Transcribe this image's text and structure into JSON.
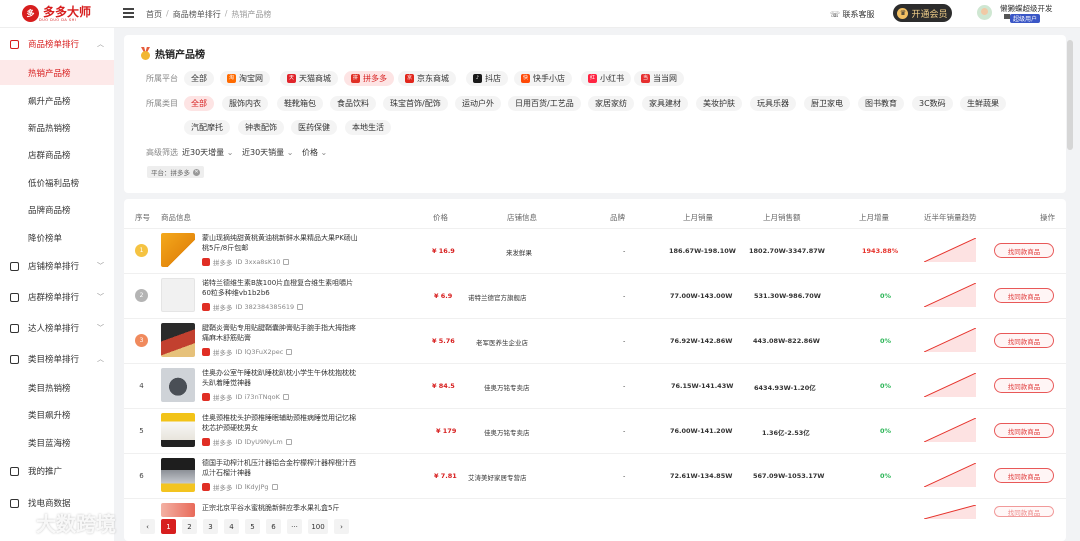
{
  "app": {
    "name": "多多大师",
    "sub": "DUO DUO DA SHI"
  },
  "breadcrumb": [
    "首页",
    "商品榜单排行",
    "热销产品榜"
  ],
  "header": {
    "contact": "联系客服",
    "vip": "开通会员",
    "user_name": "懒獭蝶超级开发",
    "user_badge": "超级用户"
  },
  "sidebar": {
    "group1": "商品榜单排行",
    "items1": [
      "热销产品榜",
      "飙升产品榜",
      "新品热销榜",
      "店群商品榜",
      "低价福利品榜",
      "品牌商品榜",
      "降价榜单"
    ],
    "group2": "店铺榜单排行",
    "group3": "店群榜单排行",
    "group4": "达人榜单排行",
    "group5": "类目榜单排行",
    "items5": [
      "类目热销榜",
      "类目飙升榜",
      "类目蓝海榜"
    ],
    "group6": "我的推广",
    "group7": "找电商数据"
  },
  "filter": {
    "title": "热销产品榜",
    "platform_label": "所属平台",
    "platforms": [
      "全部",
      "淘宝网",
      "天猫商城",
      "拼多多",
      "京东商城",
      "抖店",
      "快手小店",
      "小红书",
      "当当网"
    ],
    "category_label": "所属类目",
    "categories": [
      "全部",
      "服饰内衣",
      "鞋靴箱包",
      "食品饮料",
      "珠宝首饰/配饰",
      "运动户外",
      "日用百货/工艺品",
      "家居家纺",
      "家具建材",
      "美妆护肤",
      "玩具乐器",
      "厨卫家电",
      "图书教育",
      "3C数码",
      "生鲜蔬果",
      "汽配摩托",
      "钟表配饰",
      "医药保健",
      "本地生活"
    ],
    "advanced_label": "高级筛选",
    "selects": [
      "近30天增量",
      "近30天销量",
      "价格"
    ],
    "active_tag": "平台：拼多多"
  },
  "table": {
    "headers": [
      "序号",
      "商品信息",
      "价格",
      "店铺信息",
      "品牌",
      "上月销量",
      "上月销售额",
      "上月增量",
      "近半年销量趋势",
      "操作"
    ],
    "platform_name": "拼多多",
    "action_label": "找同款商品",
    "rows": [
      {
        "rank": "1",
        "name": "蒙山现摘纯甜黄桃黄油桃新鲜水果精品大果PK砀山桃5斤/8斤包邮",
        "id": "ID 3xxa8sK10",
        "price": "¥ 16.9",
        "shop": "来发鲜果",
        "brand": "-",
        "sales": "186.67W-198.10W",
        "revenue": "1802.70W-3347.87W",
        "growth": "1943.88%"
      },
      {
        "rank": "2",
        "name": "诺特兰德维生素B族100片血橙复合维生素咀嚼片60粒多种维vb1b2b6",
        "id": "ID 382384385619",
        "price": "¥ 6.9",
        "shop": "诺特兰德官方旗舰店",
        "brand": "-",
        "sales": "77.00W-143.00W",
        "revenue": "531.30W-986.70W",
        "growth": "0%"
      },
      {
        "rank": "3",
        "name": "腱鞘炎膏贴专用贴腱鞘囊肿膏贴手腕手指大拇指疼痛麻木舒筋贴膏",
        "id": "ID lQ3FuX2pec",
        "price": "¥ 5.76",
        "shop": "老军医养生企业店",
        "brand": "-",
        "sales": "76.92W-142.86W",
        "revenue": "443.08W-822.86W",
        "growth": "0%"
      },
      {
        "rank": "4",
        "name": "佳奥办公室午睡枕趴睡枕趴枕小学生午休枕抱枕枕头趴着睡觉神器",
        "id": "ID i73nTNqoK",
        "price": "¥ 84.5",
        "shop": "佳奥万铭专卖店",
        "brand": "-",
        "sales": "76.15W-141.43W",
        "revenue": "6434.93W-1.20亿",
        "growth": "0%"
      },
      {
        "rank": "5",
        "name": "佳奥颈椎枕头护颈椎睡眠辅助颈椎病睡觉用记忆棉枕芯护颈硬枕男女",
        "id": "ID lDyU9NyLm",
        "price": "¥ 179",
        "shop": "佳奥万铭专卖店",
        "brand": "-",
        "sales": "76.00W-141.20W",
        "revenue": "1.36亿-2.53亿",
        "growth": "0%"
      },
      {
        "rank": "6",
        "name": "德国手动榨汁机压汁器铝合金柠檬榨汁器榨橙汁西瓜汁石榴汁神器",
        "id": "ID lKdyJPg",
        "price": "¥ 7.81",
        "shop": "艾涛美好家居专营店",
        "brand": "-",
        "sales": "72.61W-134.85W",
        "revenue": "567.09W-1053.17W",
        "growth": "0%"
      },
      {
        "rank": "7",
        "name": "正宗北京平谷水蜜桃脆新鲜应季水果礼盒5斤",
        "id": "",
        "price": "",
        "shop": "",
        "brand": "",
        "sales": "",
        "revenue": "",
        "growth": ""
      }
    ]
  },
  "pager": [
    "‹",
    "1",
    "2",
    "3",
    "4",
    "5",
    "6",
    "···",
    "100",
    "›"
  ],
  "watermark": "大数跨境",
  "colors": {
    "brand": "#d71e1e",
    "green": "#29b455"
  }
}
